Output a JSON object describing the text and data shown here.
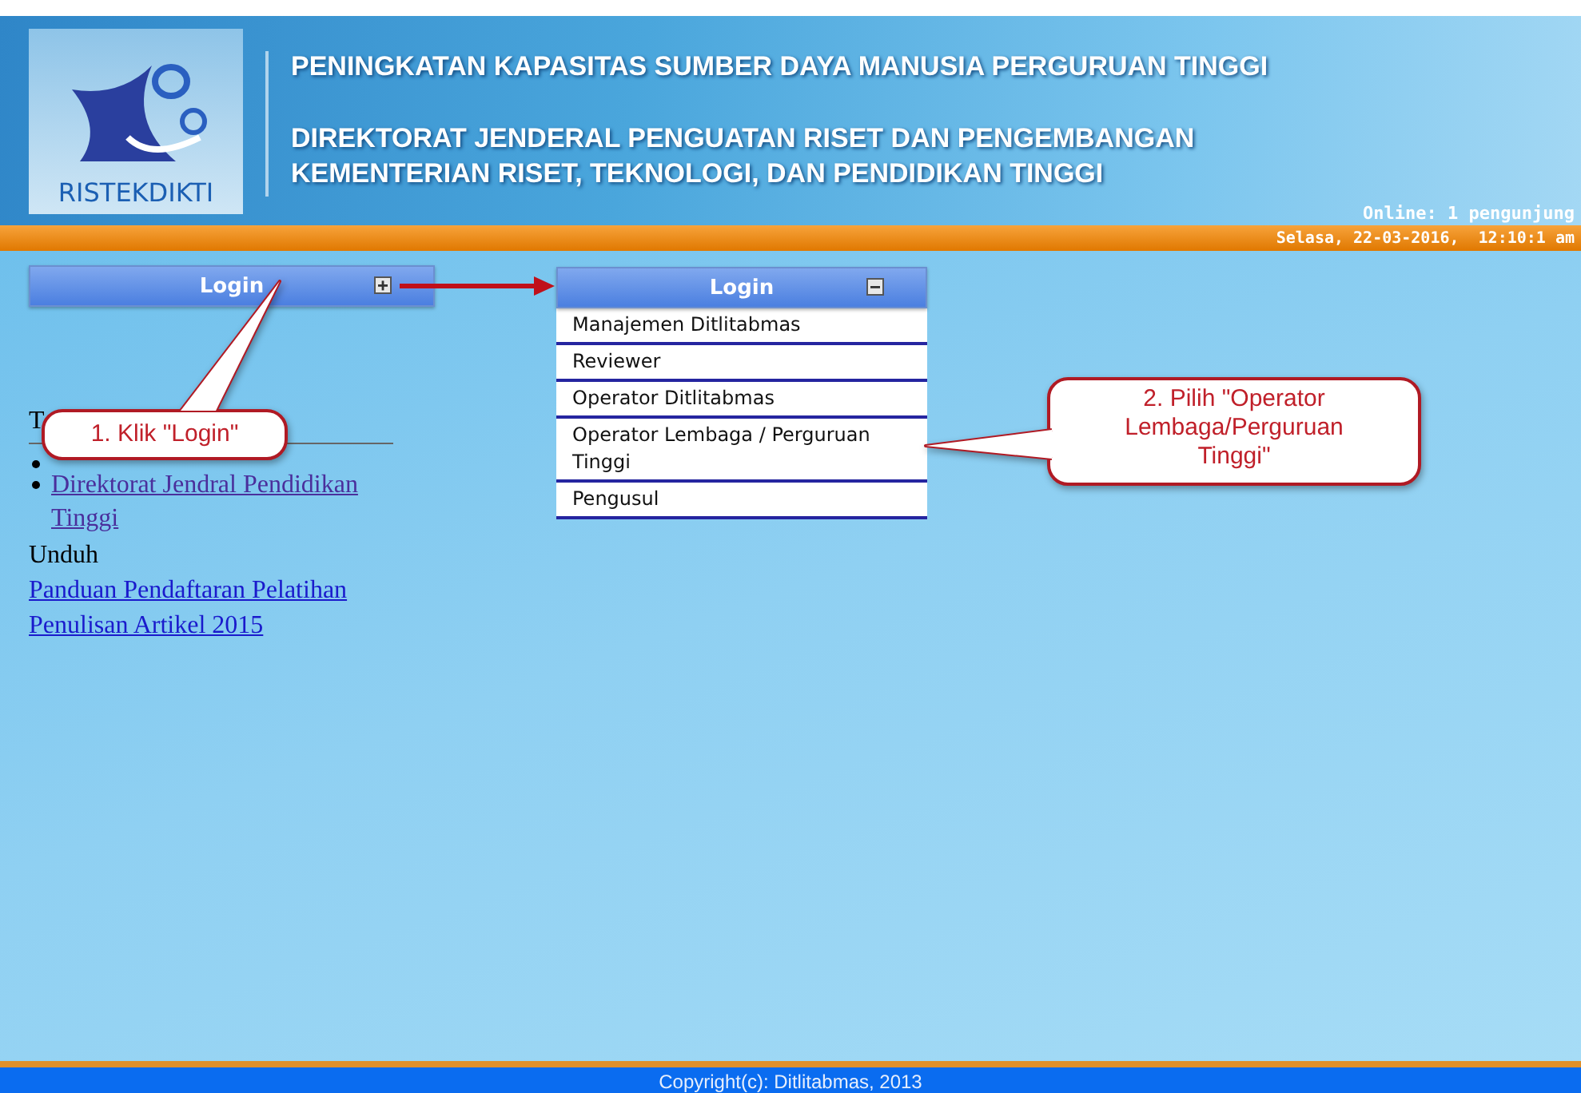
{
  "header": {
    "logo_text": "RISTEKDIKTI",
    "title": "PENINGKATAN KAPASITAS SUMBER DAYA MANUSIA PERGURUAN TINGGI",
    "subtitle_lines": [
      "DIREKTORAT JENDERAL PENGUATAN RISET DAN PENGEMBANGAN",
      "KEMENTERIAN RISET, TEKNOLOGI, DAN PENDIDIKAN TINGGI"
    ],
    "online": "Online: 1 pengunjung",
    "datetime": "Selasa, 22-03-2016,  12:10:1 am"
  },
  "sidebar": {
    "login_box": {
      "title": "Login",
      "expanded": false
    },
    "links_heading": "T",
    "links": [
      {
        "label": "Direktorat Jendral Pendidikan Tinggi",
        "visited": true
      }
    ],
    "downloads_heading": "Unduh",
    "downloads": [
      {
        "label": "Panduan Pendaftaran Pelatihan Penulisan Artikel 2015",
        "visited": false
      }
    ]
  },
  "login_menu": {
    "title": "Login",
    "expanded": true,
    "items": [
      {
        "label": "Manajemen Ditlitabmas"
      },
      {
        "label": "Reviewer"
      },
      {
        "label": "Operator Ditlitabmas"
      },
      {
        "label": "Operator Lembaga / Perguruan Tinggi"
      },
      {
        "label": "Pengusul"
      }
    ]
  },
  "annotations": [
    {
      "text": "1. Klik \"Login\""
    },
    {
      "text": "2. Pilih \"Operator Lembaga/Perguruan Tinggi\""
    }
  ],
  "footer": {
    "copyright": "Copyright(c): Ditlitabmas, 2013"
  }
}
